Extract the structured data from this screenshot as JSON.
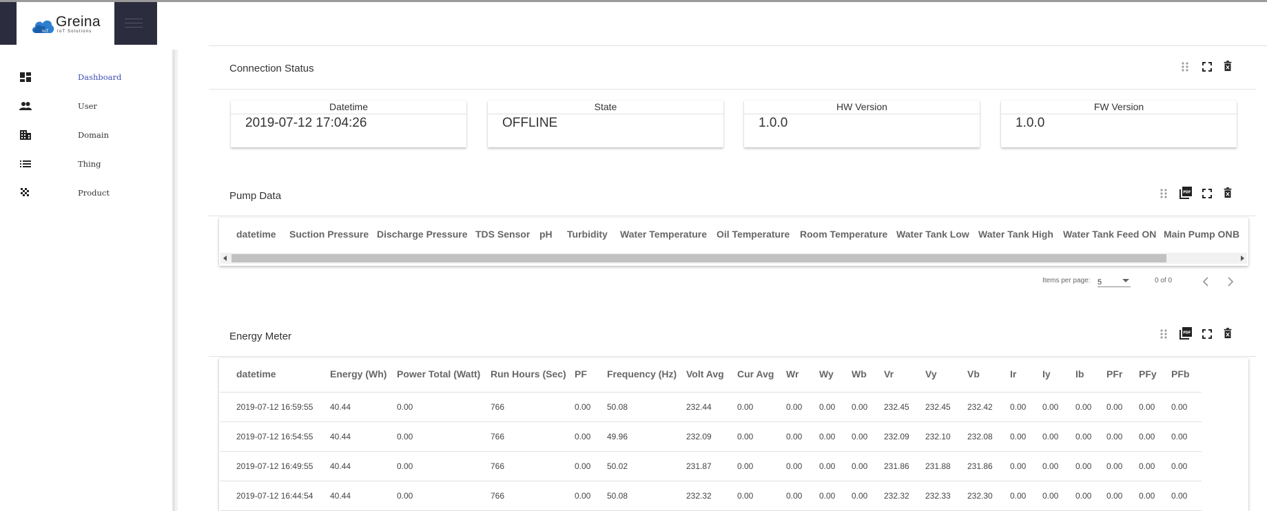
{
  "brand": {
    "name": "Greina",
    "tagline": "IoT Solutions"
  },
  "sidebar": {
    "items": [
      {
        "label": "Dashboard",
        "icon": "dashboard-icon",
        "active": true
      },
      {
        "label": "User",
        "icon": "people-icon",
        "active": false
      },
      {
        "label": "Domain",
        "icon": "building-icon",
        "active": false
      },
      {
        "label": "Thing",
        "icon": "list-icon",
        "active": false
      },
      {
        "label": "Product",
        "icon": "product-icon",
        "active": false
      }
    ]
  },
  "connection_status": {
    "title": "Connection Status",
    "cards": [
      {
        "title": "Datetime",
        "value": "2019-07-12 17:04:26"
      },
      {
        "title": "State",
        "value": "OFFLINE"
      },
      {
        "title": "HW Version",
        "value": "1.0.0"
      },
      {
        "title": "FW Version",
        "value": "1.0.0"
      }
    ]
  },
  "pump_data": {
    "title": "Pump Data",
    "columns": [
      "datetime",
      "Suction Pressure",
      "Discharge Pressure",
      "TDS Sensor",
      "pH",
      "Turbidity",
      "Water Temperature",
      "Oil Temperature",
      "Room Temperature",
      "Water Tank Low",
      "Water Tank High",
      "Water Tank Feed ON",
      "Main Pump ON",
      "B"
    ],
    "paginator": {
      "items_per_page_label": "Items per page:",
      "items_per_page": "5",
      "range": "0 of 0"
    }
  },
  "energy_meter": {
    "title": "Energy Meter",
    "columns": [
      "datetime",
      "Energy (Wh)",
      "Power Total (Watt)",
      "Run Hours (Sec)",
      "PF",
      "Frequency (Hz)",
      "Volt Avg",
      "Cur Avg",
      "Wr",
      "Wy",
      "Wb",
      "Vr",
      "Vy",
      "Vb",
      "Ir",
      "Iy",
      "Ib",
      "PFr",
      "PFy",
      "PFb"
    ],
    "rows": [
      [
        "2019-07-12 16:59:55",
        "40.44",
        "0.00",
        "766",
        "0.00",
        "50.08",
        "232.44",
        "0.00",
        "0.00",
        "0.00",
        "0.00",
        "232.45",
        "232.45",
        "232.42",
        "0.00",
        "0.00",
        "0.00",
        "0.00",
        "0.00",
        "0.00"
      ],
      [
        "2019-07-12 16:54:55",
        "40.44",
        "0.00",
        "766",
        "0.00",
        "49.96",
        "232.09",
        "0.00",
        "0.00",
        "0.00",
        "0.00",
        "232.09",
        "232.10",
        "232.08",
        "0.00",
        "0.00",
        "0.00",
        "0.00",
        "0.00",
        "0.00"
      ],
      [
        "2019-07-12 16:49:55",
        "40.44",
        "0.00",
        "766",
        "0.00",
        "50.02",
        "231.87",
        "0.00",
        "0.00",
        "0.00",
        "0.00",
        "231.86",
        "231.88",
        "231.86",
        "0.00",
        "0.00",
        "0.00",
        "0.00",
        "0.00",
        "0.00"
      ],
      [
        "2019-07-12 16:44:54",
        "40.44",
        "0.00",
        "766",
        "0.00",
        "50.08",
        "232.32",
        "0.00",
        "0.00",
        "0.00",
        "0.00",
        "232.32",
        "232.33",
        "232.30",
        "0.00",
        "0.00",
        "0.00",
        "0.00",
        "0.00",
        "0.00"
      ]
    ]
  },
  "colors": {
    "topbar": "#2b2d3e",
    "accent": "#3f51b5",
    "logo_blue": "#2f7fd0"
  }
}
